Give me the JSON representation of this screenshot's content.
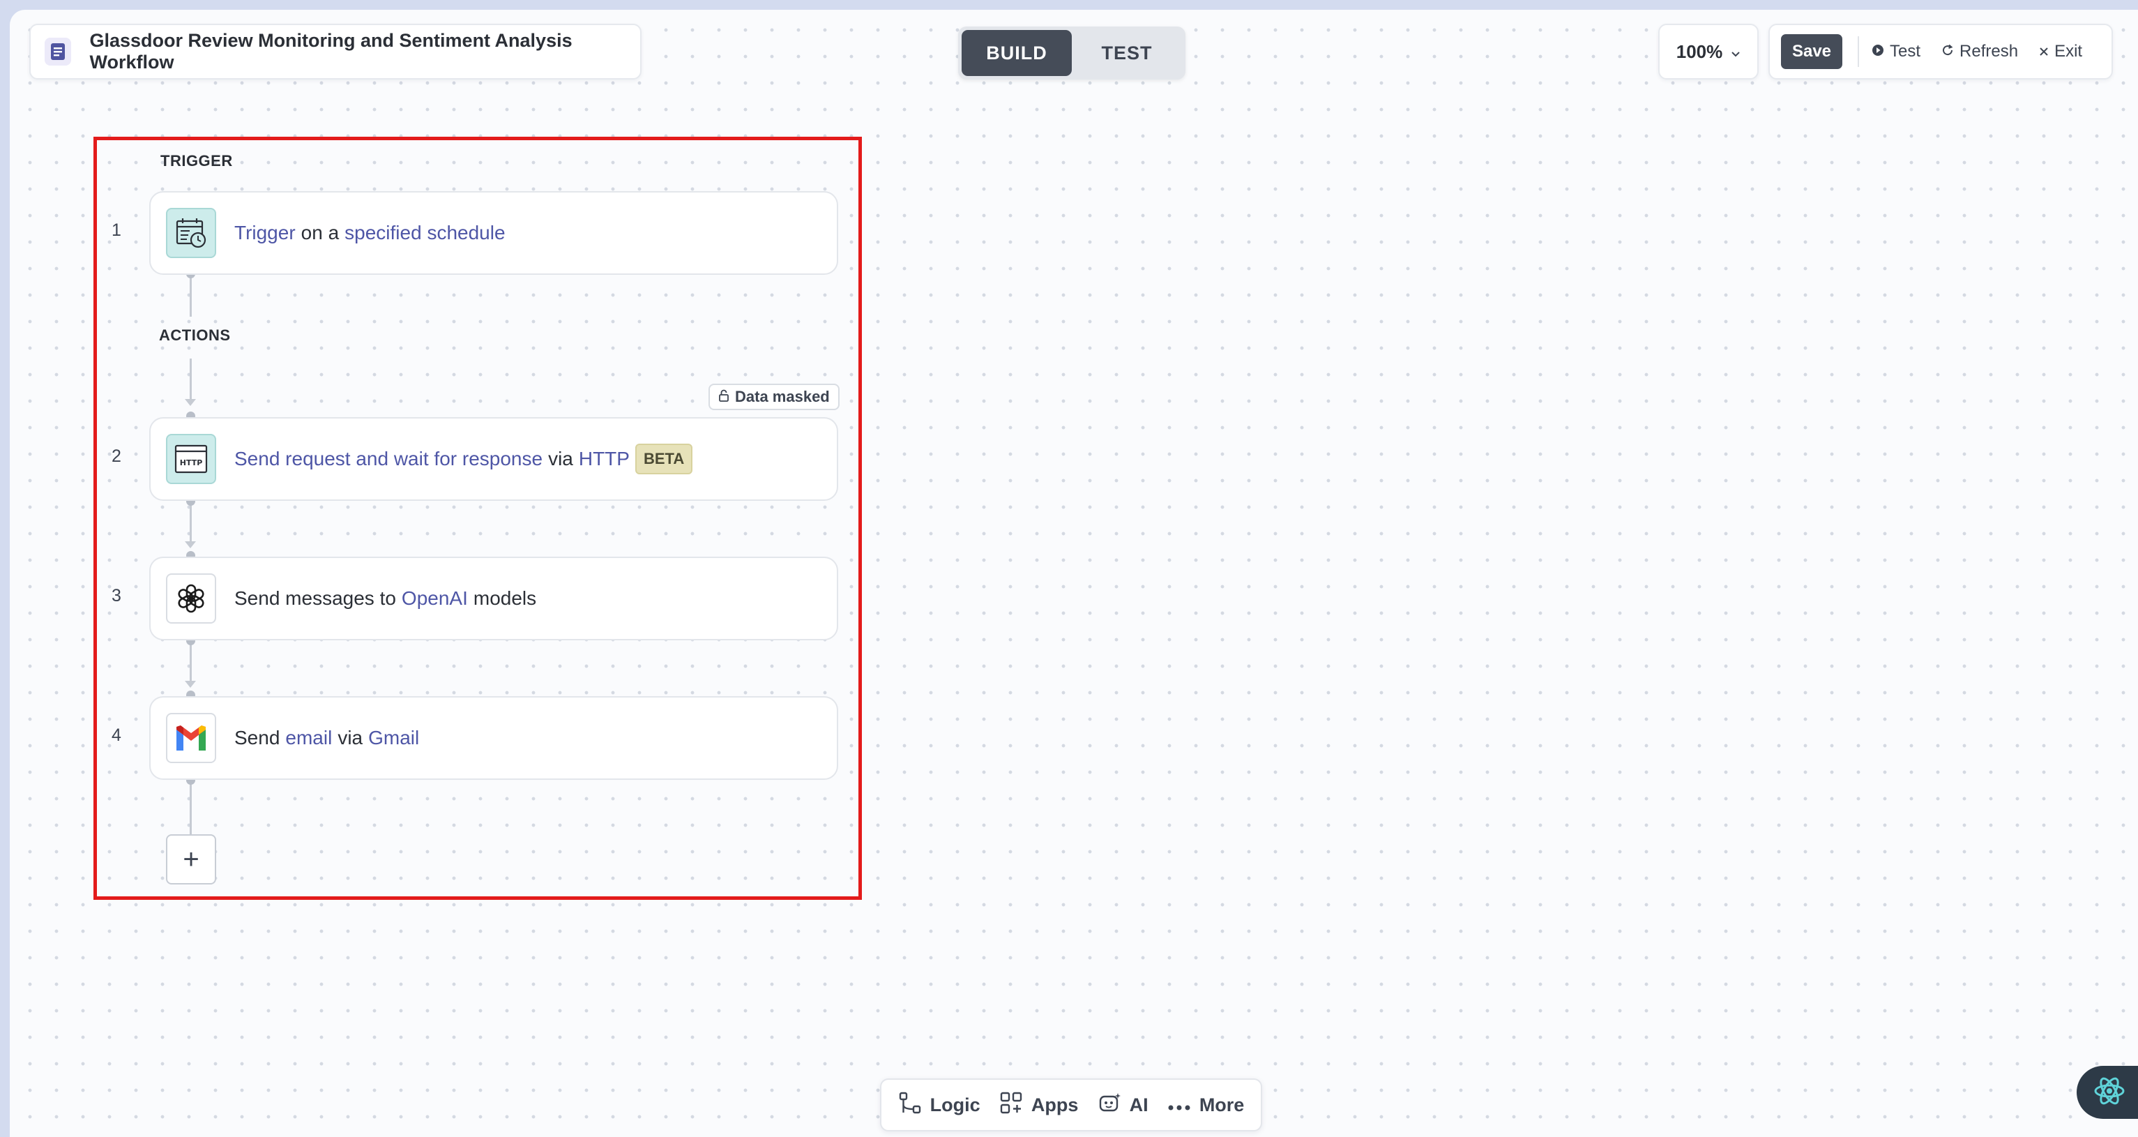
{
  "workflow": {
    "title": "Glassdoor Review Monitoring and Sentiment Analysis Workflow"
  },
  "mode_toggle": {
    "build_label": "BUILD",
    "test_label": "TEST",
    "active": "BUILD"
  },
  "zoom": {
    "value": "100%"
  },
  "toolbar": {
    "save_label": "Save",
    "test_label": "Test",
    "refresh_label": "Refresh",
    "exit_label": "Exit"
  },
  "sections": {
    "trigger_label": "TRIGGER",
    "actions_label": "ACTIONS"
  },
  "steps": [
    {
      "number": "1",
      "icon": "calendar-clock-icon",
      "parts": [
        "Trigger",
        "on a",
        "specified schedule"
      ]
    },
    {
      "number": "2",
      "icon": "http-icon",
      "parts": [
        "Send request and wait for response",
        "via",
        "HTTP"
      ],
      "badge": "BETA",
      "tag": "Data masked"
    },
    {
      "number": "3",
      "icon": "openai-icon",
      "parts": [
        "Send messages to",
        "OpenAI",
        "models"
      ]
    },
    {
      "number": "4",
      "icon": "gmail-icon",
      "parts": [
        "Send",
        "email",
        "via",
        "Gmail"
      ]
    }
  ],
  "add_step": {
    "label": "+"
  },
  "bottom_bar": {
    "logic_label": "Logic",
    "apps_label": "Apps",
    "ai_label": "AI",
    "more_label": "More"
  },
  "colors": {
    "accent": "#4e56a6",
    "dark": "#454c58",
    "highlight_border": "#e31b1b",
    "teal_icon_bg": "#cdeceb"
  }
}
